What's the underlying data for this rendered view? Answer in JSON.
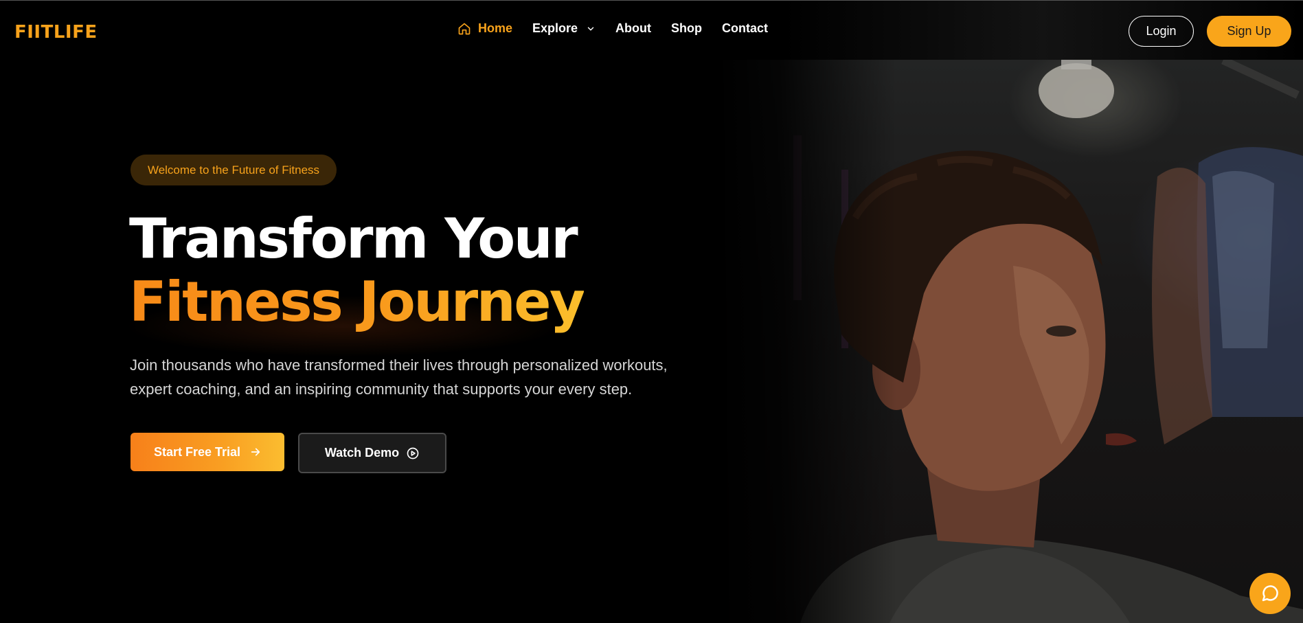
{
  "brand": {
    "name": "FIITLIFE",
    "accent_color": "#f7a21b"
  },
  "nav": {
    "items": [
      {
        "label": "Home",
        "icon": "home-icon",
        "active": true
      },
      {
        "label": "Explore",
        "icon": "chevron-down-icon",
        "has_dropdown": true
      },
      {
        "label": "About"
      },
      {
        "label": "Shop"
      },
      {
        "label": "Contact"
      }
    ],
    "login_label": "Login",
    "signup_label": "Sign Up"
  },
  "hero": {
    "badge": "Welcome to the Future of Fitness",
    "headline_line1": "Transform Your",
    "headline_line2": "Fitness Journey",
    "subtext": "Join thousands who have transformed their lives through personalized workouts, expert coaching, and an inspiring community that supports your every step.",
    "primary_cta": {
      "label": "Start Free Trial",
      "icon": "arrow-right-icon"
    },
    "secondary_cta": {
      "label": "Watch Demo",
      "icon": "play-circle-icon"
    }
  },
  "chat": {
    "icon": "chat-bubble-icon"
  },
  "colors": {
    "background": "#000000",
    "accent": "#f7a21b",
    "accent_gradient_start": "#f7801a",
    "accent_gradient_end": "#fbbd30",
    "badge_bg": "#3a2607"
  }
}
